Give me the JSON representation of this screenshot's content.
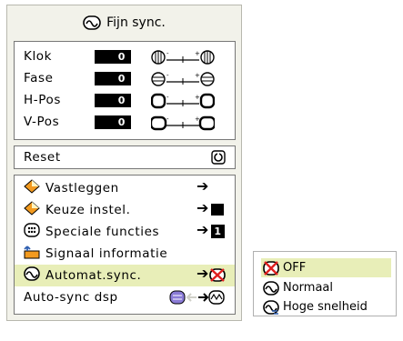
{
  "menu": {
    "title": "Fijn sync.",
    "adjust": [
      {
        "label": "Klok",
        "value": "0"
      },
      {
        "label": "Fase",
        "value": "0"
      },
      {
        "label": "H-Pos",
        "value": "0"
      },
      {
        "label": "V-Pos",
        "value": "0"
      }
    ],
    "reset_label": "Reset",
    "items": [
      {
        "label": "Vastleggen"
      },
      {
        "label": "Keuze instel."
      },
      {
        "label": "Speciale functies",
        "badge": "1"
      },
      {
        "label": "Signaal informatie"
      },
      {
        "label": "Automat.sync."
      },
      {
        "label": "Auto-sync dsp"
      }
    ]
  },
  "submenu": {
    "options": [
      {
        "label": "OFF"
      },
      {
        "label": "Normaal"
      },
      {
        "label": "Hoge snelheid"
      }
    ]
  },
  "colors": {
    "highlight": "#e8eeb8",
    "accent_orange": "#f29a1f",
    "icon_blue": "#2f5fb0"
  }
}
